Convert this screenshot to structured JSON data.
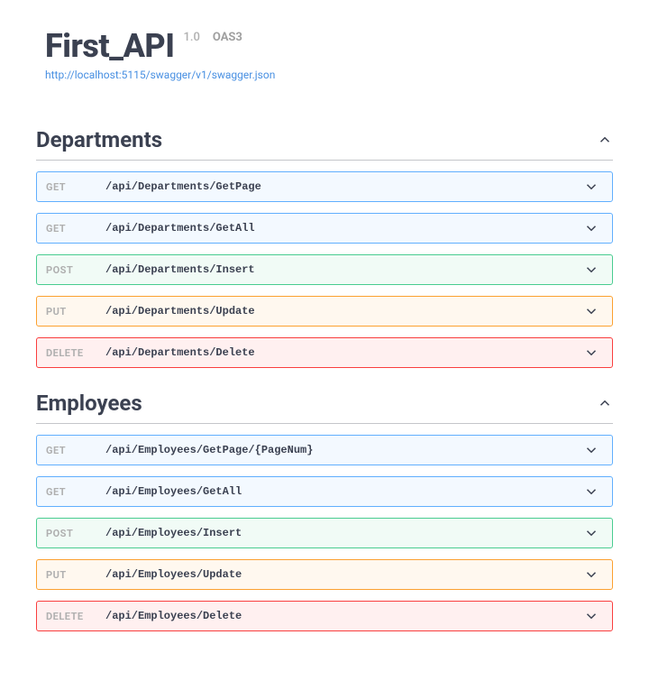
{
  "header": {
    "title": "First_API",
    "version": "1.0",
    "oas": "OAS3",
    "spec_url": "http://localhost:5115/swagger/v1/swagger.json"
  },
  "method_colors": {
    "GET": "#61affe",
    "POST": "#49cc90",
    "PUT": "#fca130",
    "DELETE": "#f93e3e"
  },
  "tags": [
    {
      "name": "Departments",
      "expanded": true,
      "operations": [
        {
          "method": "GET",
          "path": "/api/Departments/GetPage"
        },
        {
          "method": "GET",
          "path": "/api/Departments/GetAll"
        },
        {
          "method": "POST",
          "path": "/api/Departments/Insert"
        },
        {
          "method": "PUT",
          "path": "/api/Departments/Update"
        },
        {
          "method": "DELETE",
          "path": "/api/Departments/Delete"
        }
      ]
    },
    {
      "name": "Employees",
      "expanded": true,
      "operations": [
        {
          "method": "GET",
          "path": "/api/Employees/GetPage/{PageNum}"
        },
        {
          "method": "GET",
          "path": "/api/Employees/GetAll"
        },
        {
          "method": "POST",
          "path": "/api/Employees/Insert"
        },
        {
          "method": "PUT",
          "path": "/api/Employees/Update"
        },
        {
          "method": "DELETE",
          "path": "/api/Employees/Delete"
        }
      ]
    }
  ]
}
